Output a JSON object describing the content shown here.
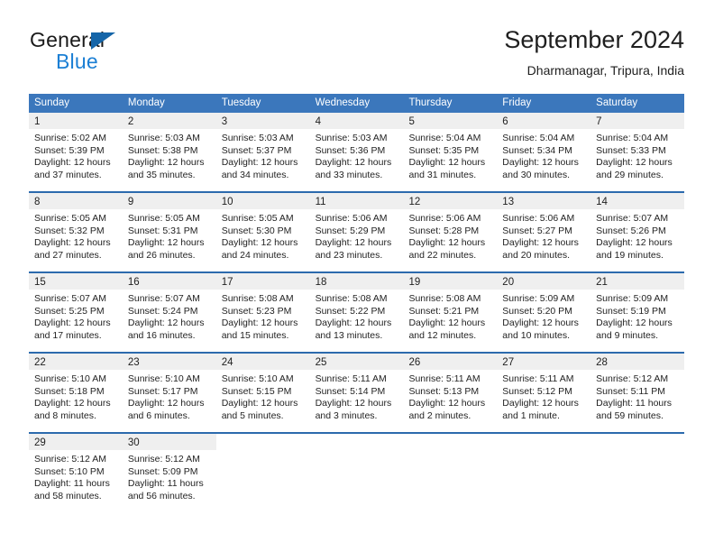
{
  "brand": {
    "word_primary": "General",
    "word_secondary": "Blue",
    "triangle_icon": "brand-triangle-icon",
    "primary_color": "#1a1a1a",
    "secondary_color": "#1b7fd4",
    "triangle_color": "#1565a8"
  },
  "header": {
    "title": "September 2024",
    "location": "Dharmanagar, Tripura, India"
  },
  "theme": {
    "header_row_bg": "#3b77bc",
    "week_divider": "#2c6aad",
    "daynum_band_bg": "#efefef",
    "text_color": "#232323"
  },
  "weekdays": [
    "Sunday",
    "Monday",
    "Tuesday",
    "Wednesday",
    "Thursday",
    "Friday",
    "Saturday"
  ],
  "weeks": [
    {
      "days": [
        {
          "day": "1",
          "sunrise": "Sunrise: 5:02 AM",
          "sunset": "Sunset: 5:39 PM",
          "daylight_1": "Daylight: 12 hours",
          "daylight_2": "and 37 minutes."
        },
        {
          "day": "2",
          "sunrise": "Sunrise: 5:03 AM",
          "sunset": "Sunset: 5:38 PM",
          "daylight_1": "Daylight: 12 hours",
          "daylight_2": "and 35 minutes."
        },
        {
          "day": "3",
          "sunrise": "Sunrise: 5:03 AM",
          "sunset": "Sunset: 5:37 PM",
          "daylight_1": "Daylight: 12 hours",
          "daylight_2": "and 34 minutes."
        },
        {
          "day": "4",
          "sunrise": "Sunrise: 5:03 AM",
          "sunset": "Sunset: 5:36 PM",
          "daylight_1": "Daylight: 12 hours",
          "daylight_2": "and 33 minutes."
        },
        {
          "day": "5",
          "sunrise": "Sunrise: 5:04 AM",
          "sunset": "Sunset: 5:35 PM",
          "daylight_1": "Daylight: 12 hours",
          "daylight_2": "and 31 minutes."
        },
        {
          "day": "6",
          "sunrise": "Sunrise: 5:04 AM",
          "sunset": "Sunset: 5:34 PM",
          "daylight_1": "Daylight: 12 hours",
          "daylight_2": "and 30 minutes."
        },
        {
          "day": "7",
          "sunrise": "Sunrise: 5:04 AM",
          "sunset": "Sunset: 5:33 PM",
          "daylight_1": "Daylight: 12 hours",
          "daylight_2": "and 29 minutes."
        }
      ]
    },
    {
      "days": [
        {
          "day": "8",
          "sunrise": "Sunrise: 5:05 AM",
          "sunset": "Sunset: 5:32 PM",
          "daylight_1": "Daylight: 12 hours",
          "daylight_2": "and 27 minutes."
        },
        {
          "day": "9",
          "sunrise": "Sunrise: 5:05 AM",
          "sunset": "Sunset: 5:31 PM",
          "daylight_1": "Daylight: 12 hours",
          "daylight_2": "and 26 minutes."
        },
        {
          "day": "10",
          "sunrise": "Sunrise: 5:05 AM",
          "sunset": "Sunset: 5:30 PM",
          "daylight_1": "Daylight: 12 hours",
          "daylight_2": "and 24 minutes."
        },
        {
          "day": "11",
          "sunrise": "Sunrise: 5:06 AM",
          "sunset": "Sunset: 5:29 PM",
          "daylight_1": "Daylight: 12 hours",
          "daylight_2": "and 23 minutes."
        },
        {
          "day": "12",
          "sunrise": "Sunrise: 5:06 AM",
          "sunset": "Sunset: 5:28 PM",
          "daylight_1": "Daylight: 12 hours",
          "daylight_2": "and 22 minutes."
        },
        {
          "day": "13",
          "sunrise": "Sunrise: 5:06 AM",
          "sunset": "Sunset: 5:27 PM",
          "daylight_1": "Daylight: 12 hours",
          "daylight_2": "and 20 minutes."
        },
        {
          "day": "14",
          "sunrise": "Sunrise: 5:07 AM",
          "sunset": "Sunset: 5:26 PM",
          "daylight_1": "Daylight: 12 hours",
          "daylight_2": "and 19 minutes."
        }
      ]
    },
    {
      "days": [
        {
          "day": "15",
          "sunrise": "Sunrise: 5:07 AM",
          "sunset": "Sunset: 5:25 PM",
          "daylight_1": "Daylight: 12 hours",
          "daylight_2": "and 17 minutes."
        },
        {
          "day": "16",
          "sunrise": "Sunrise: 5:07 AM",
          "sunset": "Sunset: 5:24 PM",
          "daylight_1": "Daylight: 12 hours",
          "daylight_2": "and 16 minutes."
        },
        {
          "day": "17",
          "sunrise": "Sunrise: 5:08 AM",
          "sunset": "Sunset: 5:23 PM",
          "daylight_1": "Daylight: 12 hours",
          "daylight_2": "and 15 minutes."
        },
        {
          "day": "18",
          "sunrise": "Sunrise: 5:08 AM",
          "sunset": "Sunset: 5:22 PM",
          "daylight_1": "Daylight: 12 hours",
          "daylight_2": "and 13 minutes."
        },
        {
          "day": "19",
          "sunrise": "Sunrise: 5:08 AM",
          "sunset": "Sunset: 5:21 PM",
          "daylight_1": "Daylight: 12 hours",
          "daylight_2": "and 12 minutes."
        },
        {
          "day": "20",
          "sunrise": "Sunrise: 5:09 AM",
          "sunset": "Sunset: 5:20 PM",
          "daylight_1": "Daylight: 12 hours",
          "daylight_2": "and 10 minutes."
        },
        {
          "day": "21",
          "sunrise": "Sunrise: 5:09 AM",
          "sunset": "Sunset: 5:19 PM",
          "daylight_1": "Daylight: 12 hours",
          "daylight_2": "and 9 minutes."
        }
      ]
    },
    {
      "days": [
        {
          "day": "22",
          "sunrise": "Sunrise: 5:10 AM",
          "sunset": "Sunset: 5:18 PM",
          "daylight_1": "Daylight: 12 hours",
          "daylight_2": "and 8 minutes."
        },
        {
          "day": "23",
          "sunrise": "Sunrise: 5:10 AM",
          "sunset": "Sunset: 5:17 PM",
          "daylight_1": "Daylight: 12 hours",
          "daylight_2": "and 6 minutes."
        },
        {
          "day": "24",
          "sunrise": "Sunrise: 5:10 AM",
          "sunset": "Sunset: 5:15 PM",
          "daylight_1": "Daylight: 12 hours",
          "daylight_2": "and 5 minutes."
        },
        {
          "day": "25",
          "sunrise": "Sunrise: 5:11 AM",
          "sunset": "Sunset: 5:14 PM",
          "daylight_1": "Daylight: 12 hours",
          "daylight_2": "and 3 minutes."
        },
        {
          "day": "26",
          "sunrise": "Sunrise: 5:11 AM",
          "sunset": "Sunset: 5:13 PM",
          "daylight_1": "Daylight: 12 hours",
          "daylight_2": "and 2 minutes."
        },
        {
          "day": "27",
          "sunrise": "Sunrise: 5:11 AM",
          "sunset": "Sunset: 5:12 PM",
          "daylight_1": "Daylight: 12 hours",
          "daylight_2": "and 1 minute."
        },
        {
          "day": "28",
          "sunrise": "Sunrise: 5:12 AM",
          "sunset": "Sunset: 5:11 PM",
          "daylight_1": "Daylight: 11 hours",
          "daylight_2": "and 59 minutes."
        }
      ]
    },
    {
      "days": [
        {
          "day": "29",
          "sunrise": "Sunrise: 5:12 AM",
          "sunset": "Sunset: 5:10 PM",
          "daylight_1": "Daylight: 11 hours",
          "daylight_2": "and 58 minutes."
        },
        {
          "day": "30",
          "sunrise": "Sunrise: 5:12 AM",
          "sunset": "Sunset: 5:09 PM",
          "daylight_1": "Daylight: 11 hours",
          "daylight_2": "and 56 minutes."
        },
        {
          "day": "",
          "sunrise": "",
          "sunset": "",
          "daylight_1": "",
          "daylight_2": ""
        },
        {
          "day": "",
          "sunrise": "",
          "sunset": "",
          "daylight_1": "",
          "daylight_2": ""
        },
        {
          "day": "",
          "sunrise": "",
          "sunset": "",
          "daylight_1": "",
          "daylight_2": ""
        },
        {
          "day": "",
          "sunrise": "",
          "sunset": "",
          "daylight_1": "",
          "daylight_2": ""
        },
        {
          "day": "",
          "sunrise": "",
          "sunset": "",
          "daylight_1": "",
          "daylight_2": ""
        }
      ]
    }
  ]
}
